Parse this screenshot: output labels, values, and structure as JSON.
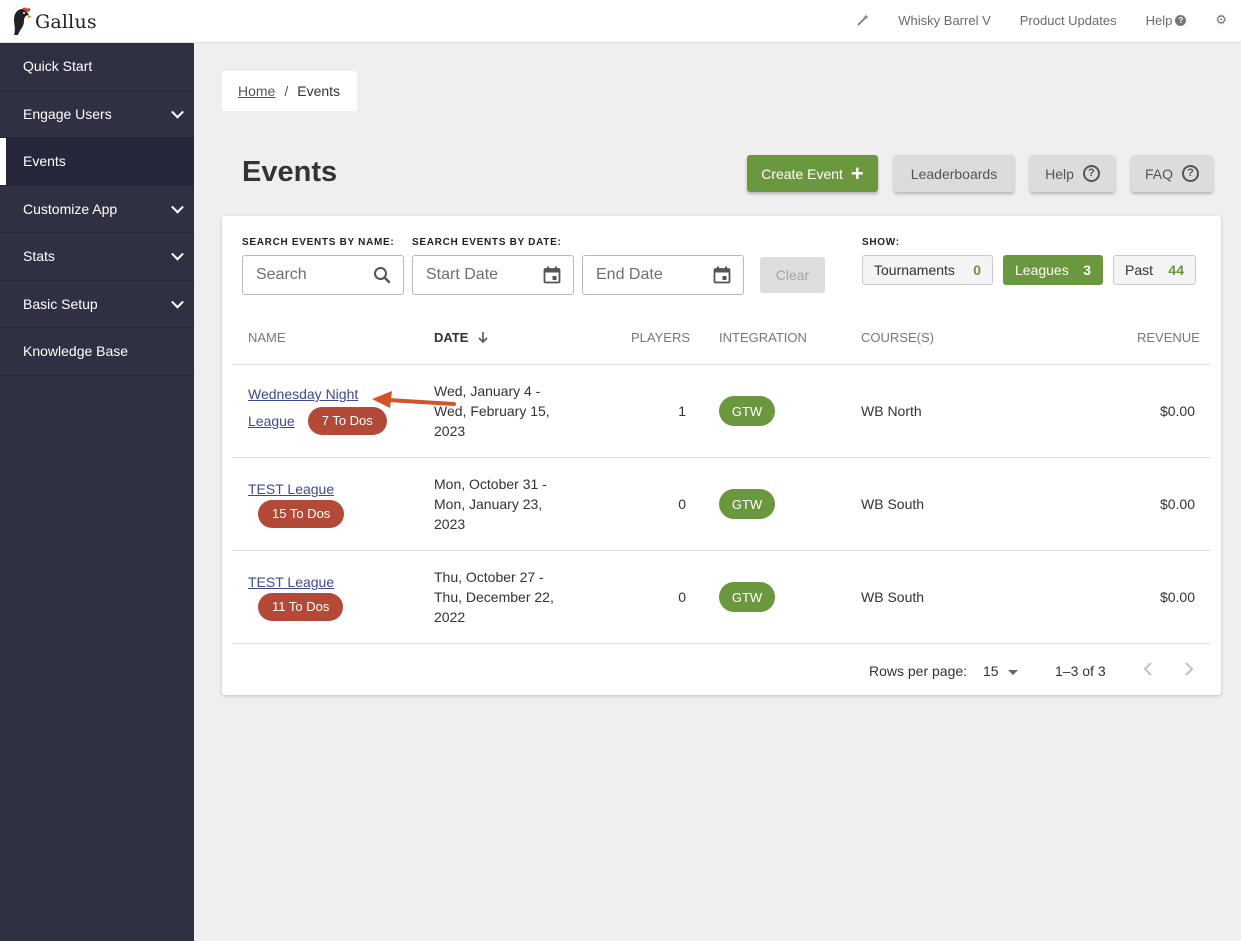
{
  "app": {
    "name": "Gallus"
  },
  "topnav": {
    "account": "Whisky Barrel V",
    "updates": "Product Updates",
    "help": "Help"
  },
  "sidebar": {
    "items": [
      {
        "label": "Quick Start",
        "expandable": false,
        "active": false
      },
      {
        "label": "Engage Users",
        "expandable": true,
        "active": false
      },
      {
        "label": "Events",
        "expandable": false,
        "active": true
      },
      {
        "label": "Customize App",
        "expandable": true,
        "active": false
      },
      {
        "label": "Stats",
        "expandable": true,
        "active": false
      },
      {
        "label": "Basic Setup",
        "expandable": true,
        "active": false
      },
      {
        "label": "Knowledge Base",
        "expandable": false,
        "active": false
      }
    ]
  },
  "breadcrumb": {
    "home": "Home",
    "sep": "/",
    "current": "Events"
  },
  "page": {
    "title": "Events"
  },
  "actions": {
    "create": "Create Event",
    "leaderboards": "Leaderboards",
    "help": "Help",
    "faq": "FAQ"
  },
  "filters": {
    "name_label": "SEARCH EVENTS BY NAME:",
    "date_label": "SEARCH EVENTS BY DATE:",
    "search_placeholder": "Search",
    "start_placeholder": "Start Date",
    "end_placeholder": "End Date",
    "clear": "Clear",
    "show_label": "SHOW:",
    "chips": [
      {
        "label": "Tournaments",
        "count": "0",
        "selected": false
      },
      {
        "label": "Leagues",
        "count": "3",
        "selected": true
      },
      {
        "label": "Past",
        "count": "44",
        "selected": false
      }
    ]
  },
  "table": {
    "headers": {
      "name": "NAME",
      "date": "DATE",
      "players": "PLAYERS",
      "integration": "INTEGRATION",
      "courses": "COURSE(S)",
      "revenue": "REVENUE"
    },
    "rows": [
      {
        "name_line1": "Wednesday Night",
        "name_line2": "League",
        "todos": "7 To Dos",
        "date1": "Wed, January 4 -",
        "date2": "Wed, February 15,",
        "date3": "2023",
        "players": "1",
        "integration": "GTW",
        "course": "WB North",
        "revenue": "$0.00"
      },
      {
        "name_line1": "TEST League",
        "name_line2": "",
        "todos": "15 To Dos",
        "date1": "Mon, October 31 -",
        "date2": "Mon, January 23,",
        "date3": "2023",
        "players": "0",
        "integration": "GTW",
        "course": "WB South",
        "revenue": "$0.00"
      },
      {
        "name_line1": "TEST League",
        "name_line2": "",
        "todos": "11 To Dos",
        "date1": "Thu, October 27 -",
        "date2": "Thu, December 22,",
        "date3": "2022",
        "players": "0",
        "integration": "GTW",
        "course": "WB South",
        "revenue": "$0.00"
      }
    ]
  },
  "pagination": {
    "rows_label": "Rows per page:",
    "rows_value": "15",
    "range": "1–3 of 3"
  },
  "colors": {
    "sidebar": "#2f3042",
    "accent_green": "#6b973e",
    "todo_red": "#b24a37",
    "annotation_arrow": "#d4532a"
  }
}
